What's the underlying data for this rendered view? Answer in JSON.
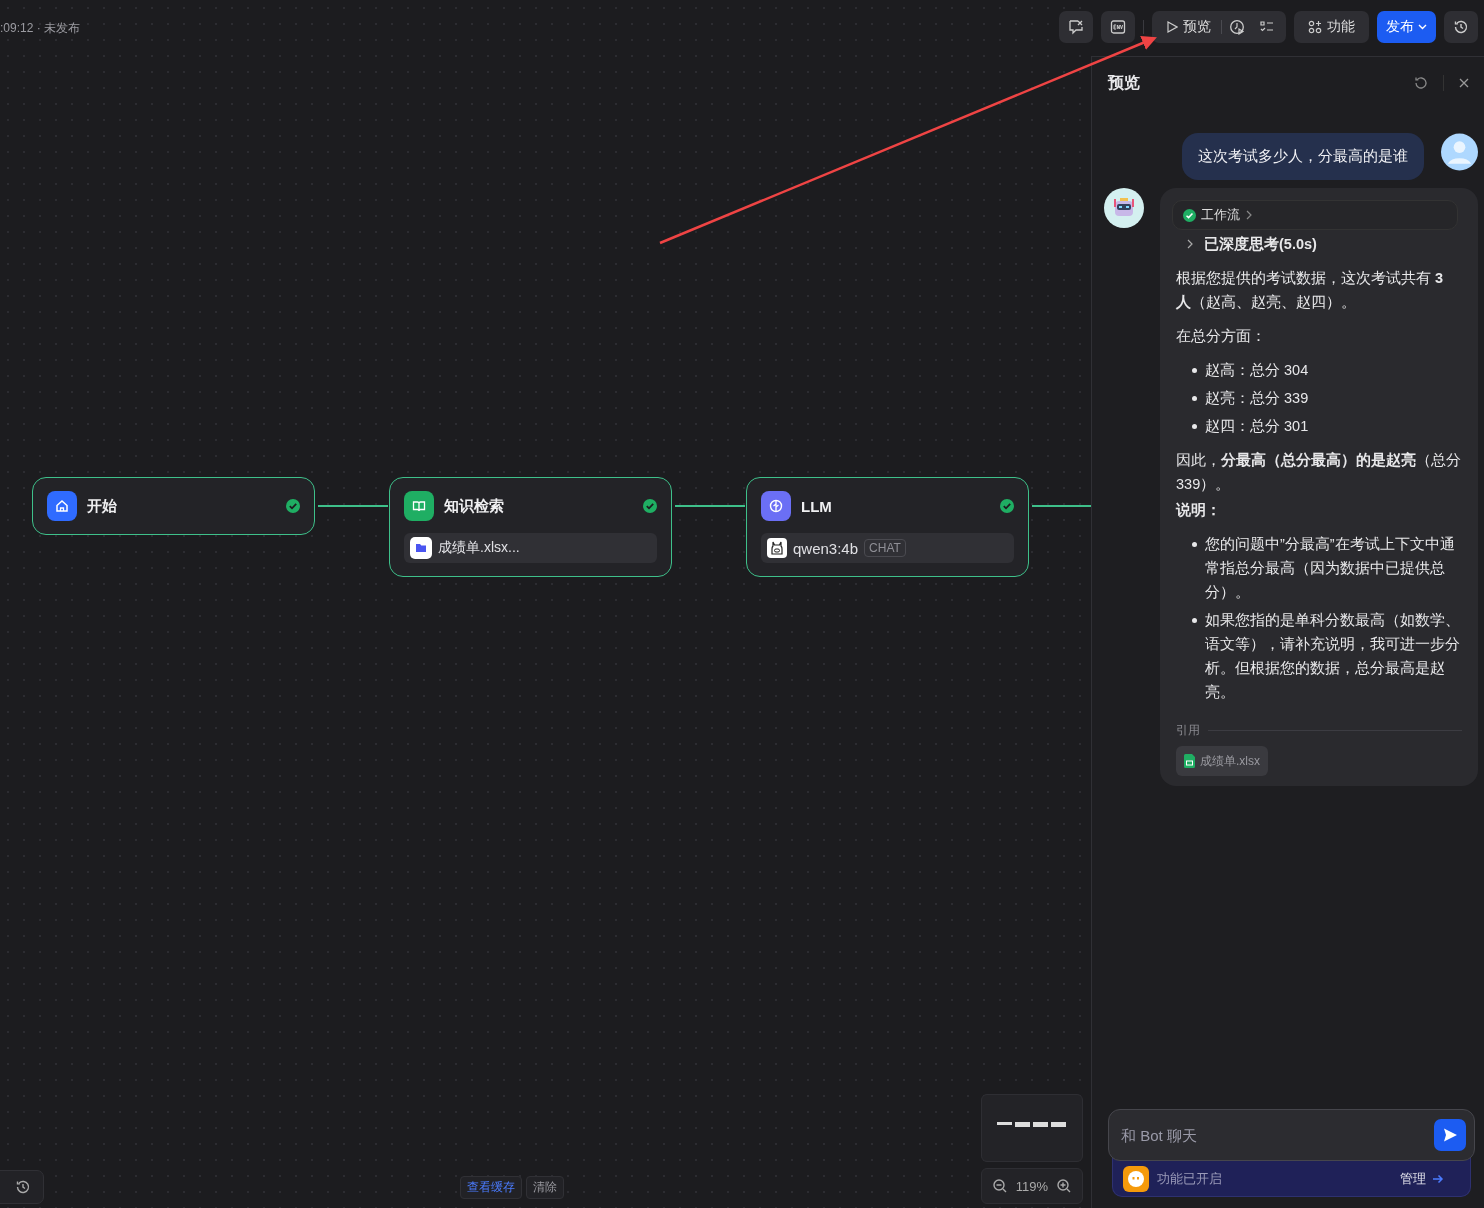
{
  "status": ":09:12 · 未发布",
  "toolbar": {
    "preview": "预览",
    "features": "功能",
    "publish": "发布"
  },
  "nodes": [
    {
      "kind": "start",
      "title": "开始",
      "done": true
    },
    {
      "kind": "knowledge",
      "title": "知识检索",
      "done": true,
      "file": "成绩单.xlsx..."
    },
    {
      "kind": "llm",
      "title": "LLM",
      "done": true,
      "model": "qwen3:4b",
      "tag": "CHAT"
    }
  ],
  "bottom": {
    "cache": "查看缓存",
    "clear": "清除",
    "zoom": "119%"
  },
  "preview": {
    "title": "预览",
    "user_message": "这次考试多少人，分最高的是谁",
    "workflow": "工作流",
    "thinking": "已深度思考(5.0s)",
    "answer": [
      {
        "kind": "paragraph",
        "text": "根据您提供的考试数据，这次考试共有 **3 人**（赵高、赵亮、赵四）。"
      },
      {
        "kind": "paragraph",
        "text": "在总分方面："
      },
      {
        "kind": "list",
        "items": [
          "赵高：总分 304",
          "赵亮：总分 339",
          "赵四：总分 301"
        ]
      },
      {
        "kind": "paragraph",
        "text": "因此，**分最高（总分最高）的是赵亮**（总分 339）。"
      },
      {
        "kind": "heading",
        "text": "说明："
      },
      {
        "kind": "list",
        "items": [
          "您的问题中”分最高”在考试上下文中通常指总分最高（因为数据中已提供总分）。",
          "如果您指的是单科分数最高（如数学、语文等），请补充说明，我可进一步分析。但根据您的数据，总分最高是赵亮。"
        ]
      }
    ],
    "citation_label": "引用",
    "citation_file": "成绩单.xlsx",
    "input_placeholder": "和 Bot 聊天",
    "feature_status": "功能已开启",
    "manage": "管理"
  }
}
